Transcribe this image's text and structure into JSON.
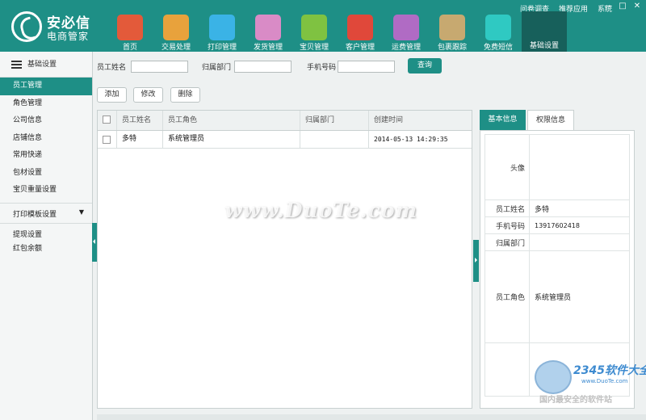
{
  "logo": {
    "brand": "安必信",
    "subtitle": "电商管家"
  },
  "top_links": [
    "问卷调查",
    "推荐应用",
    "系统"
  ],
  "window_buttons": [
    "—",
    "□",
    "✕"
  ],
  "nav": [
    {
      "label": "首页",
      "icon": "home-icon",
      "color": "#e35a3a"
    },
    {
      "label": "交易处理",
      "icon": "trade-icon",
      "color": "#e8a23c"
    },
    {
      "label": "打印管理",
      "icon": "printer-icon",
      "color": "#3ab3e6"
    },
    {
      "label": "发货管理",
      "icon": "chart-icon",
      "color": "#d98bc6"
    },
    {
      "label": "宝贝管理",
      "icon": "box-icon",
      "color": "#7fc241"
    },
    {
      "label": "客户管理",
      "icon": "user-icon",
      "color": "#e0483a"
    },
    {
      "label": "运费管理",
      "icon": "calculator-icon",
      "color": "#b06bc4"
    },
    {
      "label": "包裹跟踪",
      "icon": "clipboard-icon",
      "color": "#c7a970"
    },
    {
      "label": "免费短信",
      "icon": "mail-icon",
      "color": "#2fc9c2"
    },
    {
      "label": "基础设置",
      "icon": "gear-icon",
      "color": "#17605b",
      "active": true
    }
  ],
  "sidebar": {
    "header": "基础设置",
    "items": [
      "员工管理",
      "角色管理",
      "公司信息",
      "店铺信息",
      "常用快递",
      "包材设置",
      "宝贝重量设置"
    ],
    "group_item": "打印模板设置",
    "extra_items": [
      "提现设置",
      "红包余额"
    ]
  },
  "search": {
    "name_label": "员工姓名",
    "dept_label": "归属部门",
    "phone_label": "手机号码",
    "button": "查询"
  },
  "actions": {
    "add": "添加",
    "edit": "修改",
    "delete": "删除"
  },
  "grid": {
    "headers": [
      "员工姓名",
      "员工角色",
      "归属部门",
      "创建时间"
    ],
    "rows": [
      {
        "name": "多特",
        "role": "系统管理员",
        "dept": "",
        "created": "2014-05-13 14:29:35"
      }
    ]
  },
  "detail": {
    "tabs": [
      "基本信息",
      "权限信息"
    ],
    "fields": [
      {
        "label": "头像",
        "value": ""
      },
      {
        "label": "员工姓名",
        "value": "多特"
      },
      {
        "label": "手机号码",
        "value": "13917602418"
      },
      {
        "label": "归属部门",
        "value": ""
      },
      {
        "label": "员工角色",
        "value": "系统管理员"
      },
      {
        "label": "",
        "value": ""
      }
    ]
  },
  "watermark": {
    "main": "www.DuoTe.com",
    "logo_2345": "2345软件大全",
    "logo_url": "www.DuoTe.com",
    "tagline": "国内最安全的软件站"
  }
}
